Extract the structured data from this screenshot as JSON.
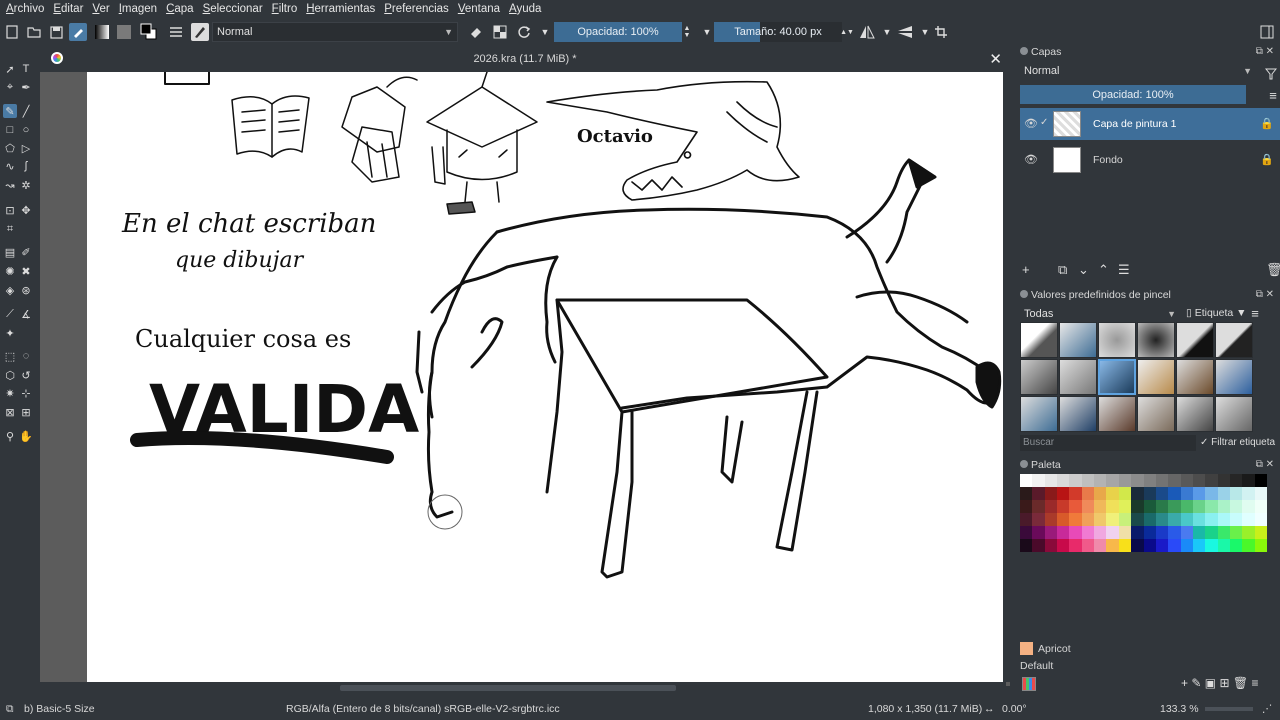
{
  "menu": [
    "Archivo",
    "Editar",
    "Ver",
    "Imagen",
    "Capa",
    "Seleccionar",
    "Filtro",
    "Herramientas",
    "Preferencias",
    "Ventana",
    "Ayuda"
  ],
  "toolbar": {
    "blend_mode": "Normal",
    "opacity_label": "Opacidad: 100%",
    "size_label": "Tamaño: 40.00 px"
  },
  "document": {
    "title": "2026.kra (11.7 MiB) *",
    "close_glyph": "✕"
  },
  "canvas_text": {
    "line1": "En el chat escriban",
    "line2": "que dibujar",
    "line3": "Cualquier cosa es",
    "big": "VALIDA",
    "croc_name": "Octavio"
  },
  "layers_docker": {
    "title": "Capas",
    "blend_mode": "Normal",
    "opacity_label": "Opacidad:  100%",
    "layers": [
      {
        "name": "Capa de pintura 1",
        "selected": true
      },
      {
        "name": "Fondo",
        "selected": false
      }
    ]
  },
  "brush_docker": {
    "title": "Valores predefinidos de pincel",
    "filter": "Todas",
    "tag_label": "Etiqueta",
    "search_placeholder": "Buscar",
    "filter_tag_label": "Filtrar etiqueta"
  },
  "palette_docker": {
    "title": "Paleta",
    "current_color_name": "Apricot",
    "palette_name": "Default",
    "current_color": "#f4b183"
  },
  "status": {
    "brush": "b) Basic-5 Size",
    "color_space": "RGB/Alfa (Entero de 8 bits/canal)  sRGB-elle-V2-srgbtrc.icc",
    "dimensions": "1,080 x 1,350 (11.7 MiB)",
    "rotation": "0.00°",
    "zoom": "133.3 %"
  },
  "colors": {
    "accent": "#3d6c94",
    "ui_bg": "#31363b",
    "canvas_bg": "#ffffff",
    "selected_layer": "#3e6e99"
  }
}
